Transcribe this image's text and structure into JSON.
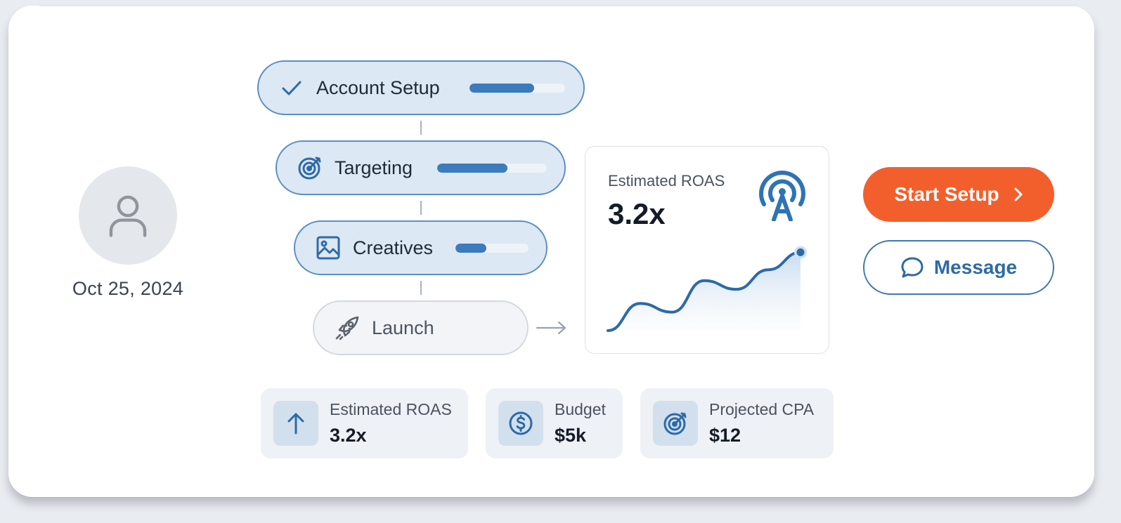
{
  "profile": {
    "date": "Oct 25, 2024",
    "avatar_icon": "user-icon"
  },
  "steps": [
    {
      "label": "Account Setup",
      "icon": "check-icon",
      "progress": 0.68
    },
    {
      "label": "Targeting",
      "icon": "target-icon",
      "progress": 0.64
    },
    {
      "label": "Creatives",
      "icon": "image-icon",
      "progress": 0.42
    },
    {
      "label": "Launch",
      "icon": "rocket-icon"
    }
  ],
  "chart_card": {
    "title": "Estimated ROAS",
    "value": "3.2x",
    "badge_icon": "broadcast-icon",
    "chart_data": {
      "type": "area",
      "x": [
        0,
        1,
        2,
        3,
        4,
        5,
        6
      ],
      "y": [
        0,
        2.5,
        1.7,
        4.6,
        3.8,
        5.6,
        7.2
      ],
      "ylim": [
        0,
        8
      ],
      "grid": false
    }
  },
  "actions": {
    "primary_label": "Start Setup",
    "secondary_label": "Message"
  },
  "stats": [
    {
      "label": "Estimated ROAS",
      "value": "3.2x",
      "icon": "arrow-up-icon"
    },
    {
      "label": "Budget",
      "value": "$5k",
      "icon": "dollar-icon"
    },
    {
      "label": "Projected CPA",
      "value": "$12",
      "icon": "target-icon"
    }
  ],
  "colors": {
    "accent": "#3c7bbc",
    "primary_button": "#f25f2c",
    "step_bg": "#dce8f4"
  }
}
